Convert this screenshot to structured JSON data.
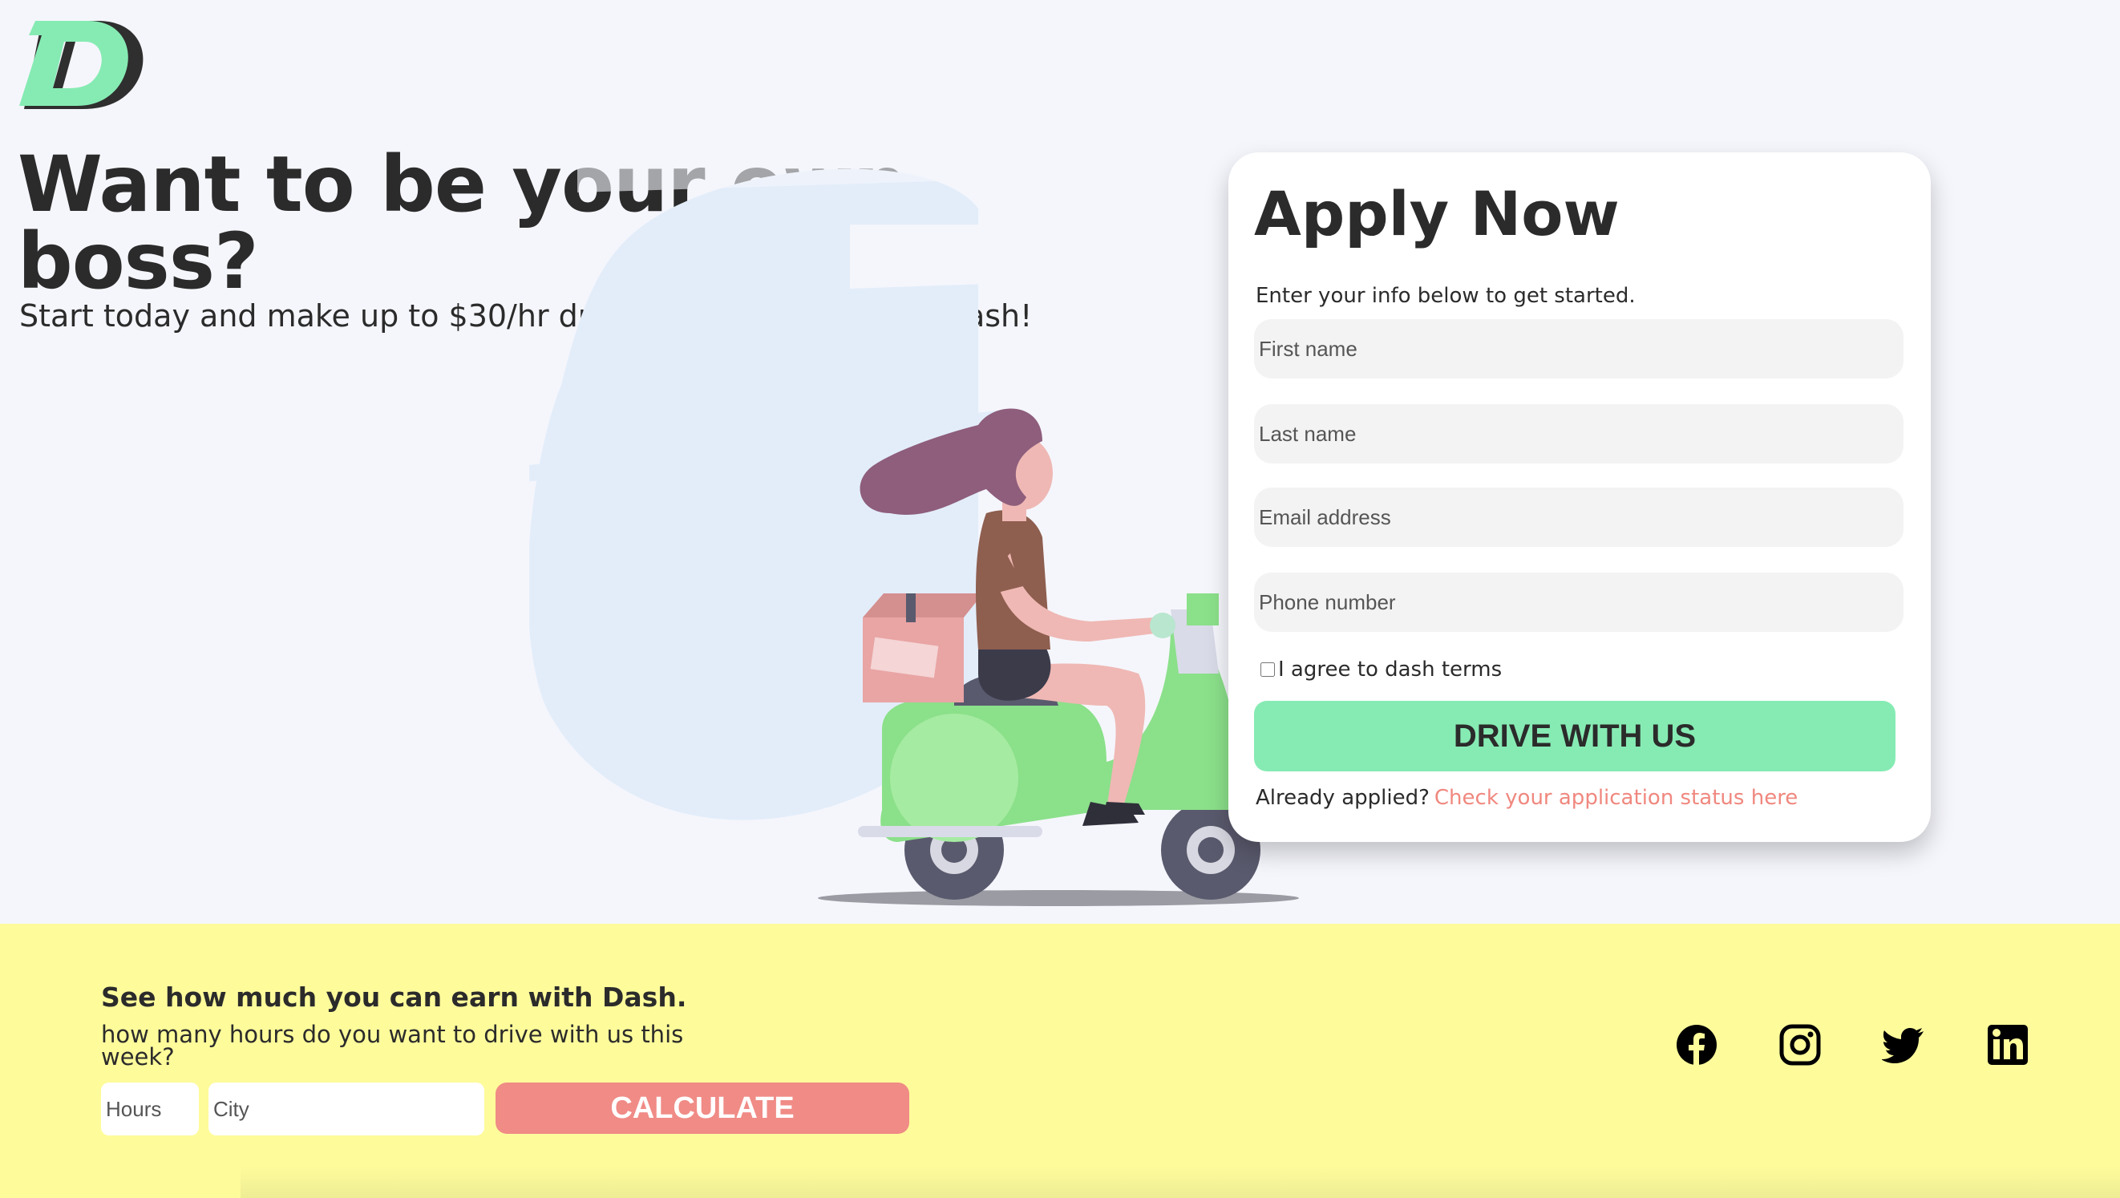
{
  "brand": {
    "logo_icon": "dash-d-logo",
    "accent_green": "#86ebb3",
    "accent_coral": "#f08b86",
    "footer_yellow": "#fefb9b"
  },
  "hero": {
    "headline": "Want to be your own boss?",
    "subline": "Start today and make up to $30/hr driving your own vehicle Dash!",
    "illustration": "woman-riding-scooter-illustration"
  },
  "apply": {
    "title": "Apply Now",
    "intro": "Enter your info below to get started.",
    "fields": {
      "first_name": "First name",
      "last_name": "Last name",
      "email": "Email address",
      "phone": "Phone number"
    },
    "terms_label": "I agree to dash terms",
    "submit_label": "DRIVE WITH US",
    "already_text": "Already applied?",
    "status_link": "Check your application status here"
  },
  "calculator": {
    "title": "See how much you can earn with Dash.",
    "question": "how many hours do you want to drive with us this week?",
    "hours_placeholder": "Hours",
    "city_placeholder": "City",
    "button_label": "CALCULATE"
  },
  "social": [
    "facebook-icon",
    "instagram-icon",
    "twitter-icon",
    "linkedin-icon"
  ]
}
